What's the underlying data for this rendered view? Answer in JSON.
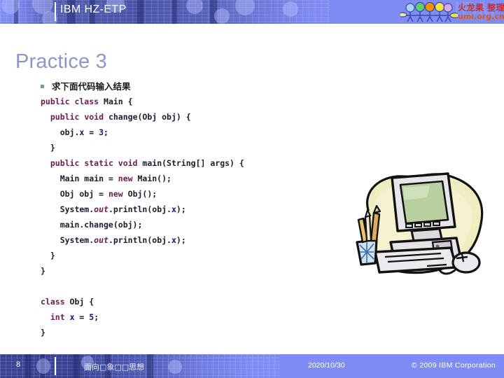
{
  "header": {
    "title": "IBM HZ-ETP",
    "ghost_logo": "IBM",
    "watermark_cn": "火龙果 整理",
    "watermark_url": "umi.org.cn",
    "logo_name": "eight-people-logo",
    "brand_red": "#d02b1e",
    "brand_orange": "#d85a10",
    "band_color": "#7f8cf5"
  },
  "slide": {
    "title": "Practice 3",
    "title_color": "#8d96c9",
    "bullet": {
      "marker": "square-bullet",
      "text": "求下面代码输入结果"
    }
  },
  "code": {
    "language": "java",
    "keyword_color": "#6d1b4e",
    "literal_color": "#14146e",
    "text_color": "#1b1b2e",
    "lines": [
      "public class Main {",
      "  public void change(Obj obj) {",
      "    obj.x = 3;",
      "  }",
      "  public static void main(String[] args) {",
      "    Main main = new Main();",
      "    Obj obj = new Obj();",
      "    System.out.println(obj.x);",
      "    main.change(obj);",
      "    System.out.println(obj.x);",
      "  }",
      "}",
      "",
      "class Obj {",
      "  int x = 5;",
      "}"
    ]
  },
  "illustration": {
    "name": "desktop-computer-clipart",
    "alt": "Desktop computer with monitor, keyboard, mouse and pencil cup"
  },
  "footer": {
    "page_number": "8",
    "topic": "面向□象□□思想",
    "date": "2020/10/30",
    "copyright": "© 2009 IBM Corporation"
  }
}
